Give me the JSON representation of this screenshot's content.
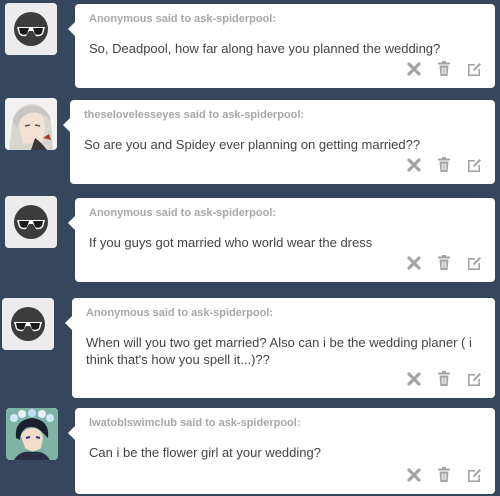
{
  "asks": [
    {
      "asker_text": "Anonymous said to ask-spiderpool:",
      "question": "So, Deadpool, how far along have you planned the wedding?",
      "avatar": "anon-sunglasses-icon"
    },
    {
      "asker_text": "theselovelesseyes said to ask-spiderpool:",
      "question": "So are you and Spidey ever planning on getting married??",
      "avatar": "anime-character-avatar"
    },
    {
      "asker_text": "Anonymous said to ask-spiderpool:",
      "question": "If you guys got married who world wear the dress",
      "avatar": "anon-sunglasses-icon"
    },
    {
      "asker_text": "Anonymous said to ask-spiderpool:",
      "question": "When will you two get married? Also can i be the wedding planer ( i think that's how you spell it...)??",
      "avatar": "anon-sunglasses-icon"
    },
    {
      "asker_text": "lwatoblswimclub said to ask-spiderpool:",
      "question": "Can i be the flower girl at your wedding?",
      "avatar": "anime-boy-flowers-avatar"
    }
  ],
  "icons": {
    "delete": "x-icon",
    "trash": "trash-icon",
    "edit": "edit-icon"
  },
  "colors": {
    "background": "#36465d",
    "card": "#ffffff",
    "asker": "#a7a7a7",
    "text": "#444444",
    "icon": "#a4a4a4"
  }
}
